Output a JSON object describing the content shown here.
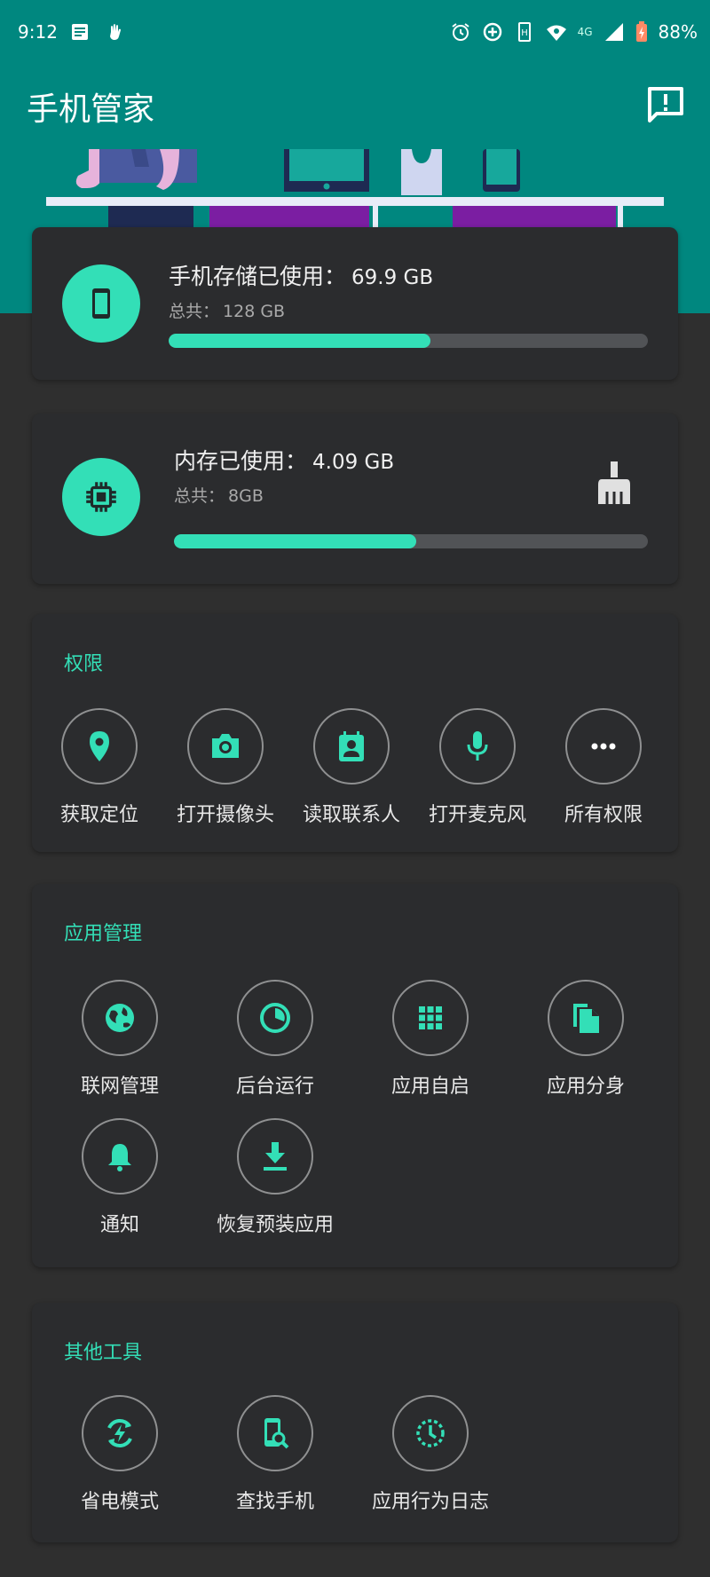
{
  "status_bar": {
    "time": "9:12",
    "network": "4G",
    "battery": "88%"
  },
  "app": {
    "title": "手机管家"
  },
  "storage": {
    "label": "手机存储已使用：",
    "used": "69.9 GB",
    "total_label": "总共：",
    "total": "128 GB",
    "fraction": 0.546
  },
  "memory": {
    "label": "内存已使用：",
    "used": "4.09 GB",
    "total_label": "总共：",
    "total": "8GB",
    "fraction": 0.511
  },
  "permissions": {
    "title": "权限",
    "items": [
      {
        "label": "获取定位",
        "icon": "location-pin-icon"
      },
      {
        "label": "打开摄像头",
        "icon": "camera-icon"
      },
      {
        "label": "读取联系人",
        "icon": "contacts-icon"
      },
      {
        "label": "打开麦克风",
        "icon": "microphone-icon"
      },
      {
        "label": "所有权限",
        "icon": "more-icon"
      }
    ]
  },
  "app_management": {
    "title": "应用管理",
    "items": [
      {
        "label": "联网管理",
        "icon": "globe-icon"
      },
      {
        "label": "后台运行",
        "icon": "pie-icon"
      },
      {
        "label": "应用自启",
        "icon": "grid-icon"
      },
      {
        "label": "应用分身",
        "icon": "duplicate-icon"
      },
      {
        "label": "通知",
        "icon": "bell-icon"
      },
      {
        "label": "恢复预装应用",
        "icon": "download-icon"
      }
    ]
  },
  "other_tools": {
    "title": "其他工具",
    "items": [
      {
        "label": "省电模式",
        "icon": "power-saving-icon"
      },
      {
        "label": "查找手机",
        "icon": "find-phone-icon"
      },
      {
        "label": "应用行为日志",
        "icon": "activity-log-icon"
      }
    ]
  },
  "colors": {
    "header": "#00877f",
    "accent": "#33dfb7",
    "background": "#2f2f2f",
    "card": "#2b2c2e"
  }
}
